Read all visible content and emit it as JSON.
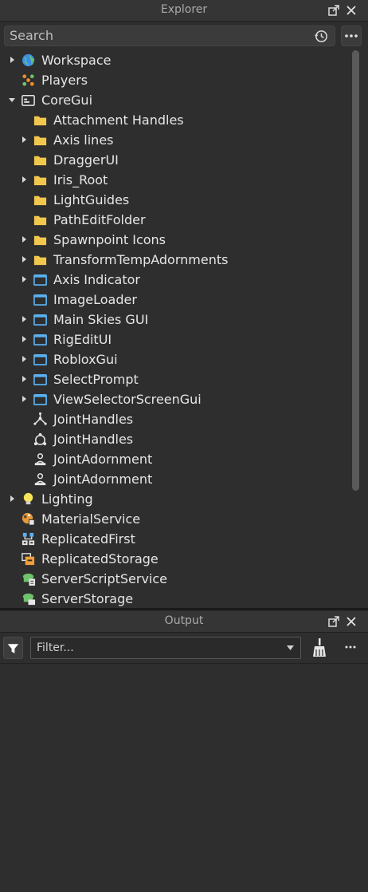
{
  "explorer": {
    "title": "Explorer",
    "search_placeholder": "Search",
    "items": [
      {
        "label": "Workspace",
        "depth": 0,
        "arrow": "right",
        "icon": "globe-icon"
      },
      {
        "label": "Players",
        "depth": 0,
        "arrow": "none",
        "icon": "players-icon"
      },
      {
        "label": "CoreGui",
        "depth": 0,
        "arrow": "down",
        "icon": "window-icon"
      },
      {
        "label": "Attachment Handles",
        "depth": 1,
        "arrow": "none",
        "icon": "folder-icon"
      },
      {
        "label": "Axis lines",
        "depth": 1,
        "arrow": "right",
        "icon": "folder-icon"
      },
      {
        "label": "DraggerUI",
        "depth": 1,
        "arrow": "none",
        "icon": "folder-icon"
      },
      {
        "label": "Iris_Root",
        "depth": 1,
        "arrow": "right",
        "icon": "folder-icon"
      },
      {
        "label": "LightGuides",
        "depth": 1,
        "arrow": "none",
        "icon": "folder-icon"
      },
      {
        "label": "PathEditFolder",
        "depth": 1,
        "arrow": "none",
        "icon": "folder-icon"
      },
      {
        "label": "Spawnpoint Icons",
        "depth": 1,
        "arrow": "right",
        "icon": "folder-icon"
      },
      {
        "label": "TransformTempAdornments",
        "depth": 1,
        "arrow": "right",
        "icon": "folder-icon"
      },
      {
        "label": "Axis Indicator",
        "depth": 1,
        "arrow": "right",
        "icon": "screengui-icon"
      },
      {
        "label": "ImageLoader",
        "depth": 1,
        "arrow": "none",
        "icon": "screengui-icon"
      },
      {
        "label": "Main Skies GUI",
        "depth": 1,
        "arrow": "right",
        "icon": "screengui-icon"
      },
      {
        "label": "RigEditUI",
        "depth": 1,
        "arrow": "right",
        "icon": "screengui-icon"
      },
      {
        "label": "RobloxGui",
        "depth": 1,
        "arrow": "right",
        "icon": "screengui-icon"
      },
      {
        "label": "SelectPrompt",
        "depth": 1,
        "arrow": "right",
        "icon": "screengui-icon"
      },
      {
        "label": "ViewSelectorScreenGui",
        "depth": 1,
        "arrow": "right",
        "icon": "screengui-icon"
      },
      {
        "label": "JointHandles",
        "depth": 1,
        "arrow": "none",
        "icon": "joint-handles-icon"
      },
      {
        "label": "JointHandles",
        "depth": 1,
        "arrow": "none",
        "icon": "joint-handles-circle-icon"
      },
      {
        "label": "JointAdornment",
        "depth": 1,
        "arrow": "none",
        "icon": "joint-adornment-icon"
      },
      {
        "label": "JointAdornment",
        "depth": 1,
        "arrow": "none",
        "icon": "joint-adornment-icon"
      },
      {
        "label": "Lighting",
        "depth": 0,
        "arrow": "right",
        "icon": "lightbulb-icon"
      },
      {
        "label": "MaterialService",
        "depth": 0,
        "arrow": "none",
        "icon": "material-service-icon"
      },
      {
        "label": "ReplicatedFirst",
        "depth": 0,
        "arrow": "none",
        "icon": "replicated-first-icon"
      },
      {
        "label": "ReplicatedStorage",
        "depth": 0,
        "arrow": "none",
        "icon": "replicated-storage-icon"
      },
      {
        "label": "ServerScriptService",
        "depth": 0,
        "arrow": "none",
        "icon": "server-script-service-icon"
      },
      {
        "label": "ServerStorage",
        "depth": 0,
        "arrow": "none",
        "icon": "server-storage-icon"
      }
    ]
  },
  "output": {
    "title": "Output",
    "filter_placeholder": "Filter..."
  },
  "colors": {
    "background": "#2e2e2e",
    "header": "#353535",
    "folder": "#f2c74e",
    "screengui": "#5ab0f0",
    "text": "#e6e6e6"
  }
}
